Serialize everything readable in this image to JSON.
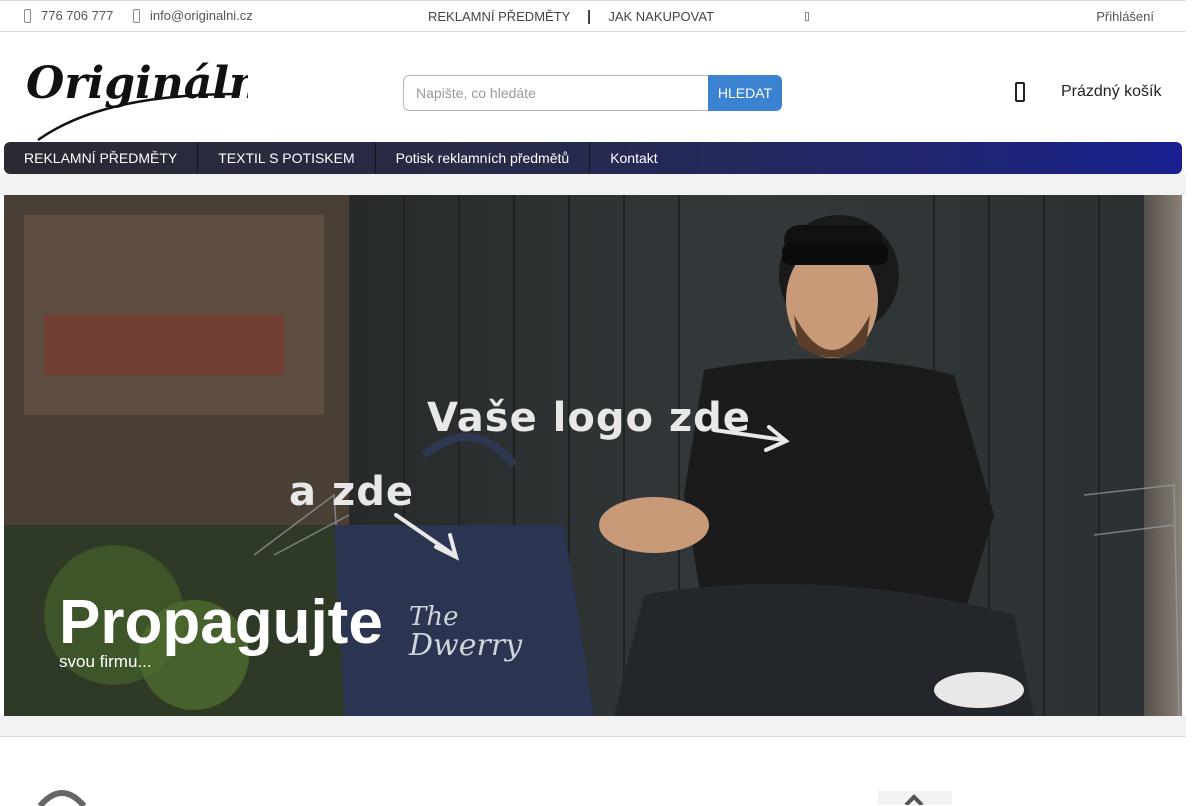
{
  "topbar": {
    "phone": "776 706 777",
    "email": "info@originalni.cz",
    "links": [
      "REKLAMNÍ PŘEDMĚTY",
      "JAK NAKUPOVAT"
    ],
    "login": "Přihlášení"
  },
  "header": {
    "logo_text": "Originální.cz",
    "search": {
      "placeholder": "Napište, co hledáte",
      "button_label": "HLEDAT"
    },
    "cart_label": "Prázdný košík"
  },
  "nav": {
    "items": [
      "REKLAMNÍ PŘEDMĚTY",
      "TEXTIL S POTISKEM",
      "Potisk reklamních předmětů",
      "Kontakt"
    ]
  },
  "hero": {
    "title": "Propagujte",
    "subtitle": "svou firmu...",
    "annotation_logo": "Vaše logo zde",
    "annotation_here": "a zde"
  },
  "colors": {
    "accent": "#3b82d1",
    "nav_start": "#2a2a33",
    "nav_end": "#1a1f90"
  }
}
